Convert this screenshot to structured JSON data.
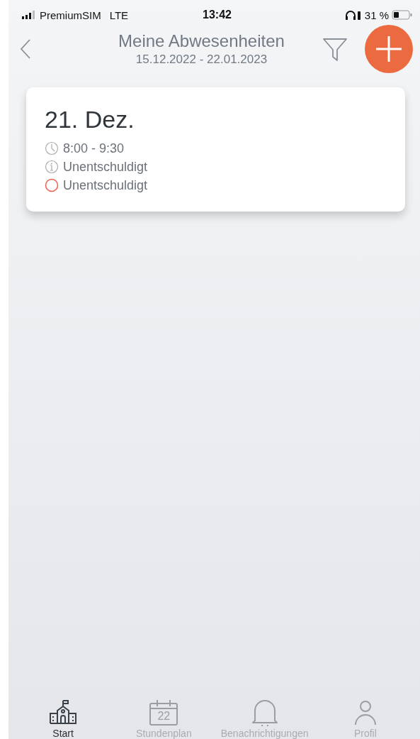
{
  "status_bar": {
    "carrier": "PremiumSIM",
    "network": "LTE",
    "time": "13:42",
    "battery": "31 %"
  },
  "header": {
    "title": "Meine Abwesenheiten",
    "subtitle": "15.12.2022 - 22.01.2023"
  },
  "absences": [
    {
      "date": "21. Dez.",
      "time": "8:00 - 9:30",
      "reason": "Unentschuldigt",
      "status": "Unentschuldigt",
      "color": "#e8604c"
    }
  ],
  "tab_bar": [
    {
      "kind": "school",
      "label": "Start",
      "selected": true
    },
    {
      "kind": "calendar",
      "label": "Stundenplan",
      "icon_text": "22",
      "selected": false
    },
    {
      "kind": "bell",
      "label": "Benachrichtigungen",
      "selected": false
    },
    {
      "kind": "person",
      "label": "Profil",
      "selected": false
    }
  ]
}
